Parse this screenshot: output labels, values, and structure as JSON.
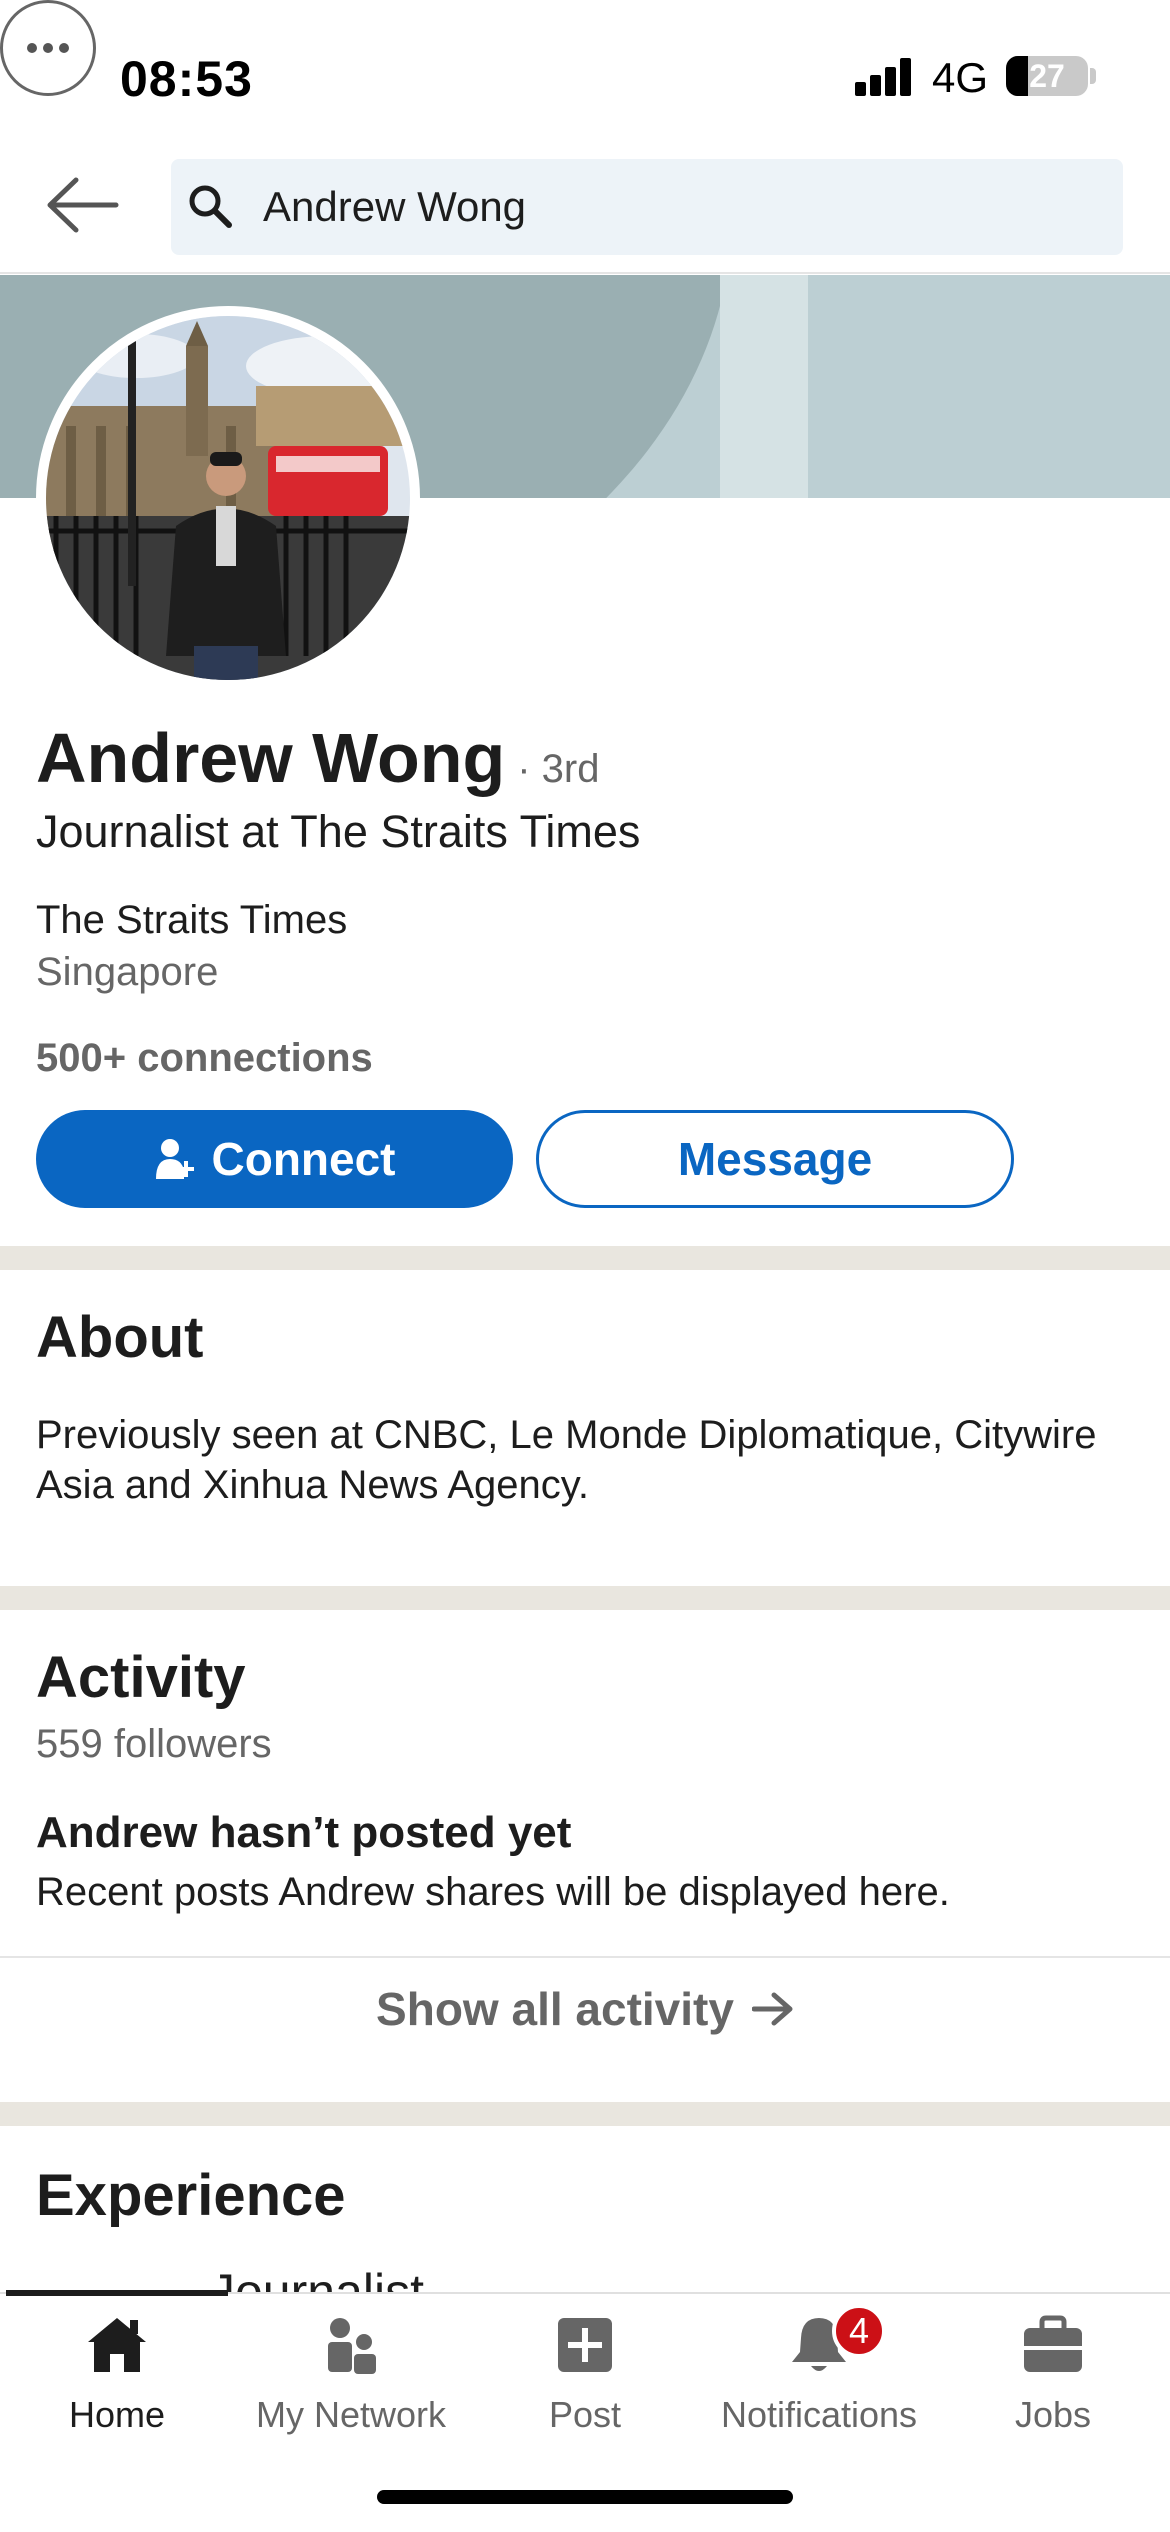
{
  "status_bar": {
    "time": "08:53",
    "network": "4G",
    "battery_level": 27,
    "battery_text": "27"
  },
  "search": {
    "query": "Andrew Wong",
    "icon": "search-icon",
    "back_icon": "back-arrow-icon"
  },
  "profile": {
    "name": "Andrew Wong",
    "degree": "· 3rd",
    "headline": "Journalist at The Straits Times",
    "company": "The Straits Times",
    "location": "Singapore",
    "connections": "500+ connections",
    "connect_label": "Connect",
    "message_label": "Message",
    "brand_color": "#0a66c2"
  },
  "about": {
    "title": "About",
    "text": "Previously seen at CNBC, Le Monde Diplomatique, Citywire Asia and Xinhua News Agency."
  },
  "activity": {
    "title": "Activity",
    "followers": "559 followers",
    "empty_title": "Andrew hasn’t posted yet",
    "empty_text": "Recent posts Andrew shares will be displayed here.",
    "show_all": "Show all activity"
  },
  "experience": {
    "title": "Experience",
    "first_item_peek": "Journalist"
  },
  "bottom_nav": {
    "items": [
      {
        "label": "Home",
        "icon": "home-icon",
        "active": true
      },
      {
        "label": "My Network",
        "icon": "network-icon",
        "active": false
      },
      {
        "label": "Post",
        "icon": "post-icon",
        "active": false
      },
      {
        "label": "Notifications",
        "icon": "bell-icon",
        "active": false,
        "badge": "4"
      },
      {
        "label": "Jobs",
        "icon": "briefcase-icon",
        "active": false
      }
    ]
  }
}
